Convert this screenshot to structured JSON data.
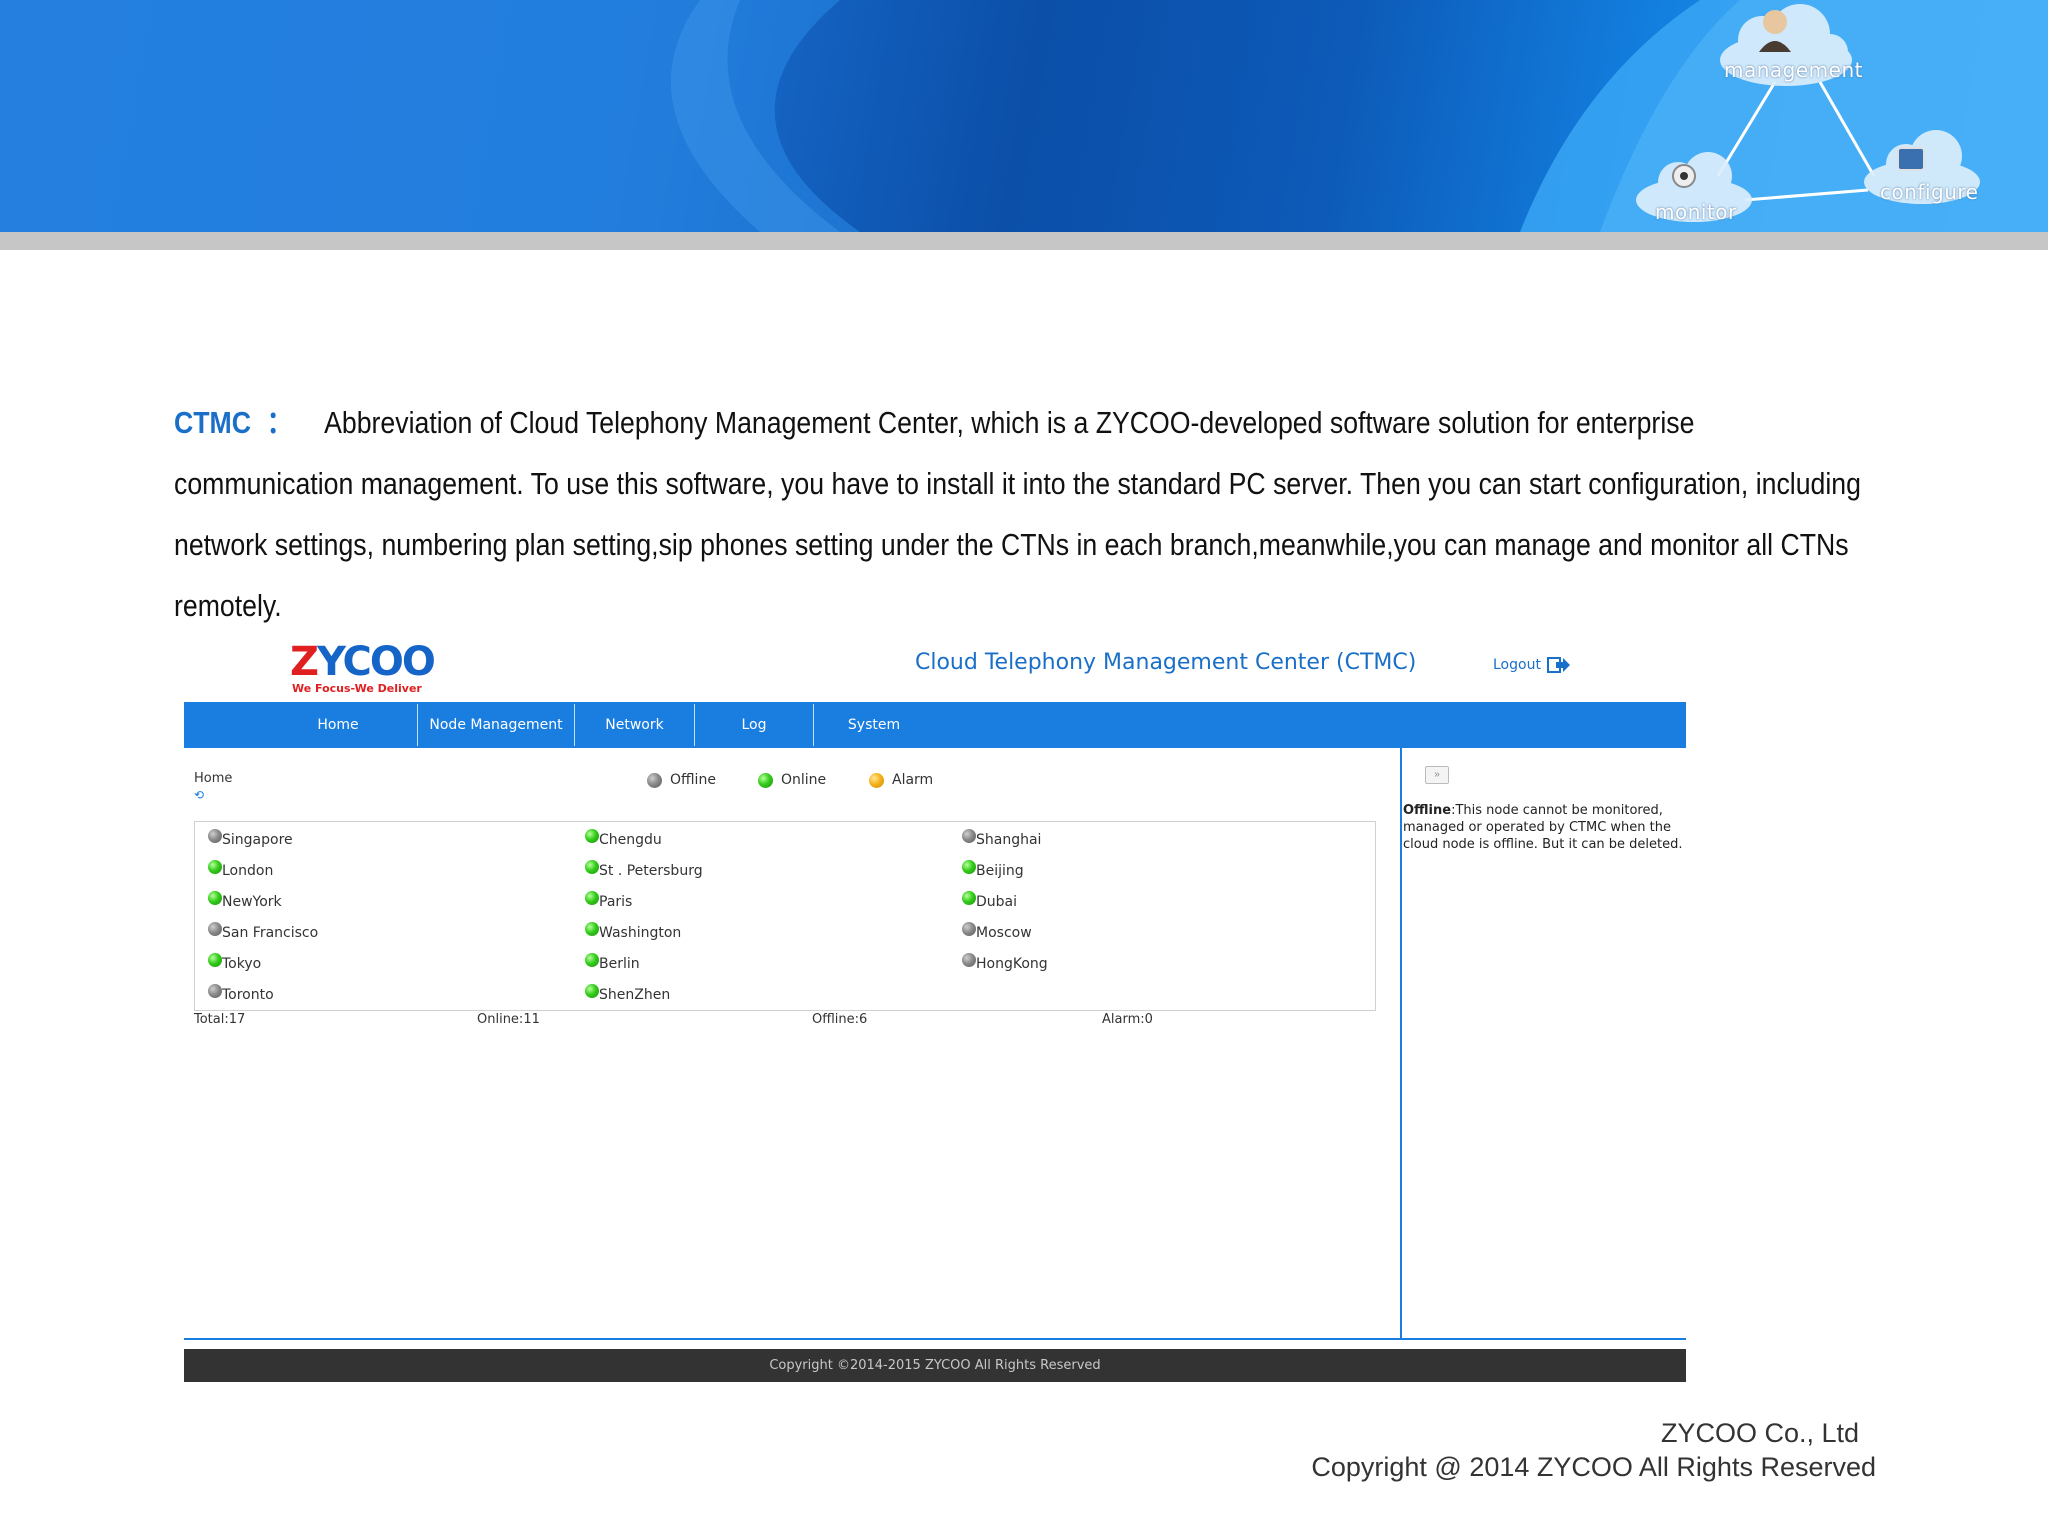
{
  "banner": {
    "diagram_labels": {
      "top": "management",
      "left": "monitor",
      "right": "configure"
    }
  },
  "intro": {
    "term": "CTMC",
    "colon": "：",
    "text": "Abbreviation of Cloud Telephony Management Center, which is a ZYCOO-developed software solution for enterprise communication management. To use this software, you have to install it into the standard PC server. Then you can start configuration, including network settings, numbering plan setting,sip phones setting under the CTNs in each branch,meanwhile,you can manage and monitor all CTNs remotely."
  },
  "app": {
    "logo": {
      "text_z": "Z",
      "text_rest": "YCOO",
      "tagline": "We Focus-We Deliver"
    },
    "title": "Cloud Telephony Management Center (CTMC)",
    "logout_label": "Logout",
    "nav": [
      "Home",
      "Node Management",
      "Network",
      "Log",
      "System"
    ],
    "breadcrumb": "Home",
    "legend": {
      "offline": "Offline",
      "online": "Online",
      "alarm": "Alarm"
    },
    "nodes": [
      [
        "Singapore",
        "offline"
      ],
      [
        "London",
        "online"
      ],
      [
        "NewYork",
        "online"
      ],
      [
        "San Francisco",
        "offline"
      ],
      [
        "Tokyo",
        "online"
      ],
      [
        "Toronto",
        "offline"
      ],
      [
        "Chengdu",
        "online"
      ],
      [
        "St . Petersburg",
        "online"
      ],
      [
        "Paris",
        "online"
      ],
      [
        "Washington",
        "online"
      ],
      [
        "Berlin",
        "online"
      ],
      [
        "ShenZhen",
        "online"
      ],
      [
        "Shanghai",
        "offline"
      ],
      [
        "Beijing",
        "online"
      ],
      [
        "Dubai",
        "online"
      ],
      [
        "Moscow",
        "offline"
      ],
      [
        "HongKong",
        "offline"
      ]
    ],
    "totals": {
      "total": "Total:17",
      "online": "Online:11",
      "offline": "Offline:6",
      "alarm": "Alarm:0"
    },
    "side_toggle": "»",
    "side_note": {
      "term": "Offline",
      "text": ":This node cannot be monitored, managed or operated by CTMC when the cloud node is offline. But it can be deleted."
    },
    "footer": "Copyright ©2014-2015 ZYCOO All Rights Reserved"
  },
  "page_footer": {
    "company": "ZYCOO Co., Ltd",
    "copyright": "Copyright @ 2014 ZYCOO All Rights Reserved"
  },
  "colors": {
    "accent": "#1a7ee0",
    "title_blue": "#1a6fc8",
    "logo_red": "#e02020",
    "footer_dark": "#333333"
  }
}
